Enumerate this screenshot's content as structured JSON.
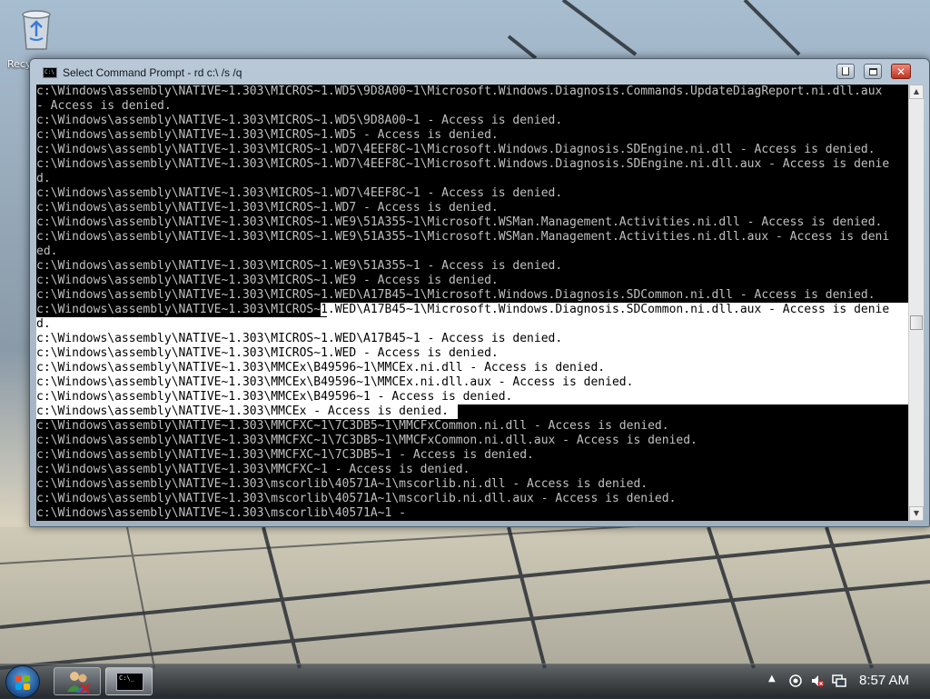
{
  "desktop": {
    "recycle_bin_label": "Recycle Bin"
  },
  "window": {
    "title": "Select Command Prompt - rd  c:\\ /s /q",
    "minimize_icon": "minimize-icon",
    "maximize_icon": "maximize-icon",
    "close_icon": "close-icon"
  },
  "console": {
    "lines": [
      "c:\\Windows\\assembly\\NATIVE~1.303\\MICROS~1.WD5\\9D8A00~1\\Microsoft.Windows.Diagnosis.Commands.UpdateDiagReport.ni.dll.aux",
      "- Access is denied.",
      "c:\\Windows\\assembly\\NATIVE~1.303\\MICROS~1.WD5\\9D8A00~1 - Access is denied.",
      "c:\\Windows\\assembly\\NATIVE~1.303\\MICROS~1.WD5 - Access is denied.",
      "c:\\Windows\\assembly\\NATIVE~1.303\\MICROS~1.WD7\\4EEF8C~1\\Microsoft.Windows.Diagnosis.SDEngine.ni.dll - Access is denied.",
      "c:\\Windows\\assembly\\NATIVE~1.303\\MICROS~1.WD7\\4EEF8C~1\\Microsoft.Windows.Diagnosis.SDEngine.ni.dll.aux - Access is denie",
      "d.",
      "c:\\Windows\\assembly\\NATIVE~1.303\\MICROS~1.WD7\\4EEF8C~1 - Access is denied.",
      "c:\\Windows\\assembly\\NATIVE~1.303\\MICROS~1.WD7 - Access is denied.",
      "c:\\Windows\\assembly\\NATIVE~1.303\\MICROS~1.WE9\\51A355~1\\Microsoft.WSMan.Management.Activities.ni.dll - Access is denied.",
      "c:\\Windows\\assembly\\NATIVE~1.303\\MICROS~1.WE9\\51A355~1\\Microsoft.WSMan.Management.Activities.ni.dll.aux - Access is deni",
      "ed.",
      "c:\\Windows\\assembly\\NATIVE~1.303\\MICROS~1.WE9\\51A355~1 - Access is denied.",
      "c:\\Windows\\assembly\\NATIVE~1.303\\MICROS~1.WE9 - Access is denied.",
      "c:\\Windows\\assembly\\NATIVE~1.303\\MICROS~1.WED\\A17B45~1\\Microsoft.Windows.Diagnosis.SDCommon.ni.dll - Access is denied.",
      "c:\\Windows\\assembly\\NATIVE~1.303\\MICROS~1.WED\\A17B45~1\\Microsoft.Windows.Diagnosis.SDCommon.ni.dll.aux - Access is denie",
      "d.",
      "c:\\Windows\\assembly\\NATIVE~1.303\\MICROS~1.WED\\A17B45~1 - Access is denied.",
      "c:\\Windows\\assembly\\NATIVE~1.303\\MICROS~1.WED - Access is denied.",
      "c:\\Windows\\assembly\\NATIVE~1.303\\MMCEx\\B49596~1\\MMCEx.ni.dll - Access is denied.",
      "c:\\Windows\\assembly\\NATIVE~1.303\\MMCEx\\B49596~1\\MMCEx.ni.dll.aux - Access is denied.",
      "c:\\Windows\\assembly\\NATIVE~1.303\\MMCEx\\B49596~1 - Access is denied.",
      "c:\\Windows\\assembly\\NATIVE~1.303\\MMCEx - Access is denied.",
      "c:\\Windows\\assembly\\NATIVE~1.303\\MMCFXC~1\\7C3DB5~1\\MMCFxCommon.ni.dll - Access is denied.",
      "c:\\Windows\\assembly\\NATIVE~1.303\\MMCFXC~1\\7C3DB5~1\\MMCFxCommon.ni.dll.aux - Access is denied.",
      "c:\\Windows\\assembly\\NATIVE~1.303\\MMCFXC~1\\7C3DB5~1 - Access is denied.",
      "c:\\Windows\\assembly\\NATIVE~1.303\\MMCFXC~1 - Access is denied.",
      "c:\\Windows\\assembly\\NATIVE~1.303\\mscorlib\\40571A~1\\mscorlib.ni.dll - Access is denied.",
      "c:\\Windows\\assembly\\NATIVE~1.303\\mscorlib\\40571A~1\\mscorlib.ni.dll.aux - Access is denied.",
      "c:\\Windows\\assembly\\NATIVE~1.303\\mscorlib\\40571A~1 -"
    ]
  },
  "taskbar": {
    "start_icon": "windows-start-icon",
    "pinned": [
      "users-icon",
      "command-prompt-icon"
    ],
    "cmd_icon_text": "C:\\_",
    "tray_icons": [
      "show-hidden-icons-arrow",
      "network-sharing-icon",
      "speaker-muted-icon",
      "network-icon"
    ],
    "tray_arrow_glyph": "▲",
    "clock": "8:57 AM"
  }
}
